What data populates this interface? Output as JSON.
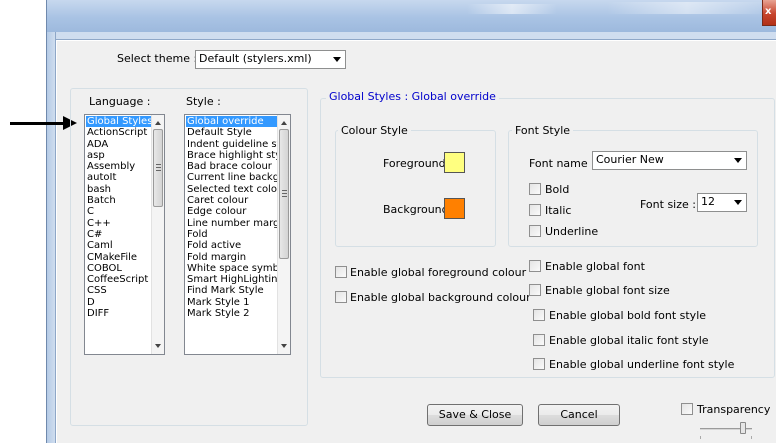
{
  "dialog": {
    "select_theme_label": "Select theme :",
    "theme_value": "Default (stylers.xml)",
    "close_glyph": "x"
  },
  "language": {
    "label": "Language :",
    "items": [
      "Global Styles",
      "ActionScript",
      "ADA",
      "asp",
      "Assembly",
      "autoIt",
      "bash",
      "Batch",
      "C",
      "C++",
      "C#",
      "Caml",
      "CMakeFile",
      "COBOL",
      "CoffeeScript",
      "CSS",
      "D",
      "DIFF"
    ],
    "selected": "Global Styles"
  },
  "style": {
    "label": "Style :",
    "items": [
      "Global override",
      "Default Style",
      "Indent guideline st",
      "Brace highlight styl",
      "Bad brace colour",
      "Current line backgi",
      "Selected text colou",
      "Caret colour",
      "Edge colour",
      "Line number marg",
      "Fold",
      "Fold active",
      "Fold margin",
      "White space symb",
      "Smart HighLighting",
      "Find Mark Style",
      "Mark Style 1",
      "Mark Style 2"
    ],
    "selected": "Global override"
  },
  "panel": {
    "title": "Global Styles : Global override",
    "title_color": "#0000cc"
  },
  "colour_style": {
    "title": "Colour Style",
    "foreground_label": "Foreground",
    "foreground_color": "#ffff80",
    "background_label": "Background",
    "background_color": "#ff8000"
  },
  "font_style": {
    "title": "Font Style",
    "font_name_label": "Font name :",
    "font_name_value": "Courier New",
    "bold_label": "Bold",
    "italic_label": "Italic",
    "underline_label": "Underline",
    "font_size_label": "Font size :",
    "font_size_value": "12"
  },
  "options": {
    "global_fg": "Enable global foreground colour",
    "global_bg": "Enable global background colour",
    "global_font": "Enable global font",
    "global_font_size": "Enable global font size",
    "global_bold": "Enable global bold font style",
    "global_italic": "Enable global italic font style",
    "global_underline": "Enable global underline font style"
  },
  "buttons": {
    "save_close": "Save & Close",
    "cancel": "Cancel"
  },
  "transparency": {
    "label": "Transparency"
  }
}
